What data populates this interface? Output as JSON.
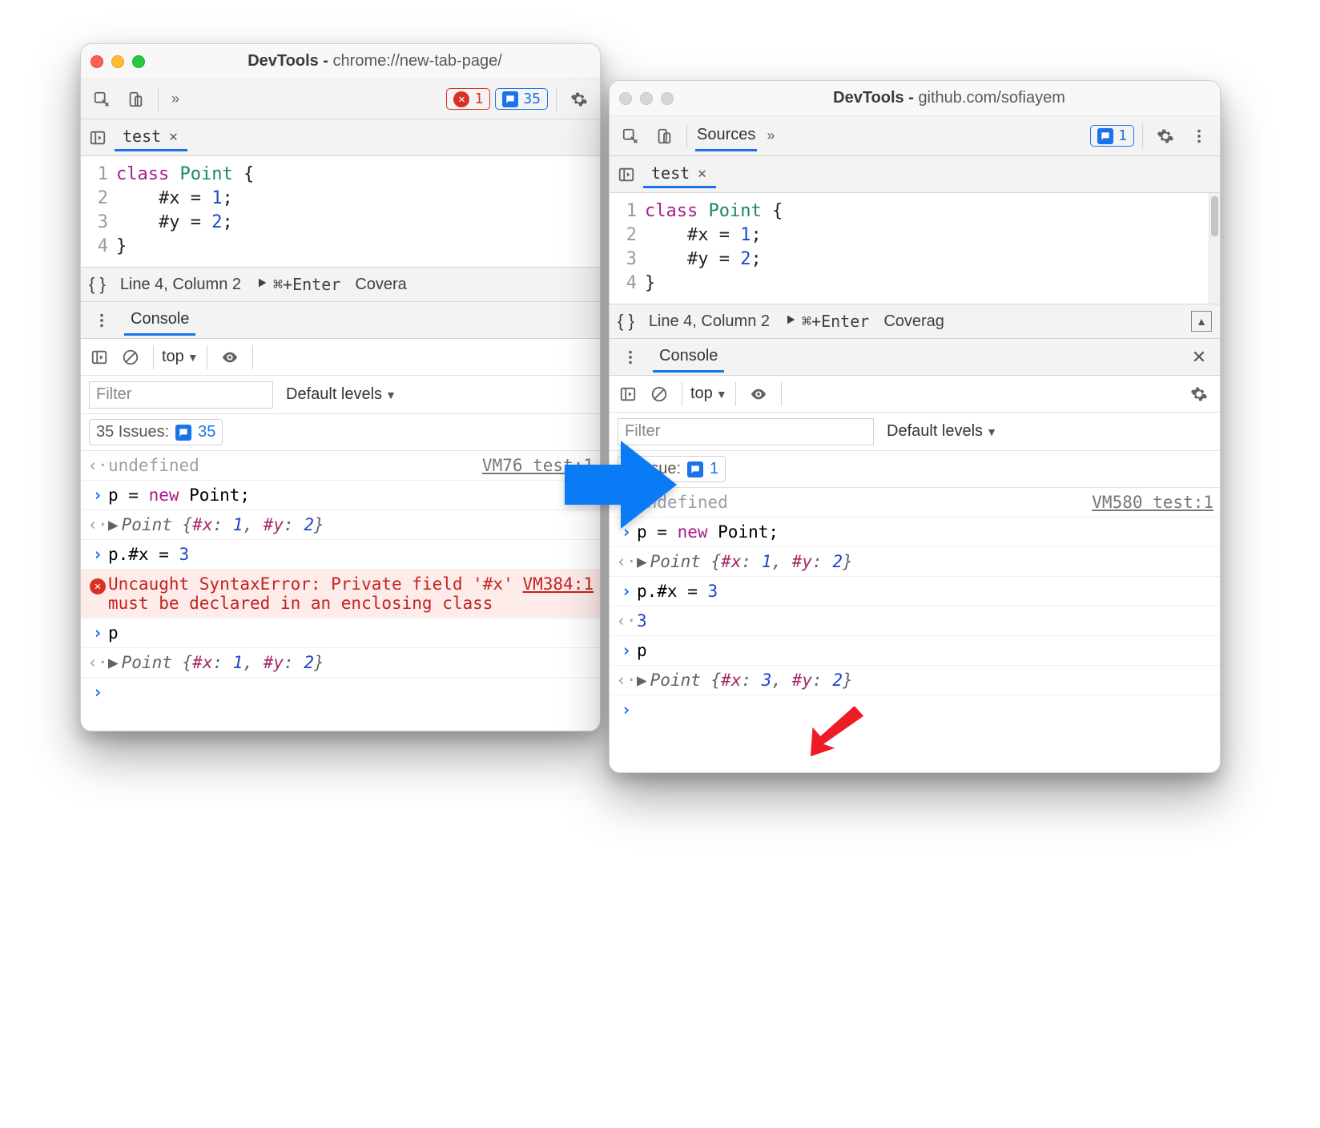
{
  "left": {
    "title_prefix": "DevTools - ",
    "title_url": "chrome://new-tab-page/",
    "errors_count": "1",
    "messages_count": "35",
    "file_tab": "test",
    "code_lines": [
      "class Point {",
      "    #x = 1;",
      "    #y = 2;",
      "}"
    ],
    "status_line_col": "Line 4, Column 2",
    "status_run": "⌘+Enter",
    "status_coverage": "Covera",
    "drawer_tab": "Console",
    "context": "top",
    "filter_placeholder": "Filter",
    "levels": "Default levels",
    "issues_label": "35 Issues:",
    "issues_count": "35",
    "log": {
      "undef": "undefined",
      "undef_src": "VM76 test:1",
      "l1": "p = new Point;",
      "r1": "Point {#x: 1, #y: 2}",
      "l2": "p.#x = 3",
      "err": "Uncaught SyntaxError: Private field '#x' must be declared in an enclosing class",
      "err_src": "VM384:1",
      "l3": "p",
      "r3": "Point {#x: 1, #y: 2}"
    }
  },
  "right": {
    "title_prefix": "DevTools - ",
    "title_url": "github.com/sofiayem",
    "sources_tab": "Sources",
    "messages_count": "1",
    "file_tab": "test",
    "code_lines": [
      "class Point {",
      "    #x = 1;",
      "    #y = 2;",
      "}"
    ],
    "status_line_col": "Line 4, Column 2",
    "status_run": "⌘+Enter",
    "status_coverage": "Coverag",
    "drawer_tab": "Console",
    "context": "top",
    "filter_placeholder": "Filter",
    "levels": "Default levels",
    "issues_label": "1 Issue:",
    "issues_count": "1",
    "log": {
      "undef": "undefined",
      "undef_src": "VM580 test:1",
      "l1": "p = new Point;",
      "r1": "Point {#x: 1, #y: 2}",
      "l2": "p.#x = 3",
      "r2": "3",
      "l3": "p",
      "r3": "Point {#x: 3, #y: 2}"
    }
  }
}
